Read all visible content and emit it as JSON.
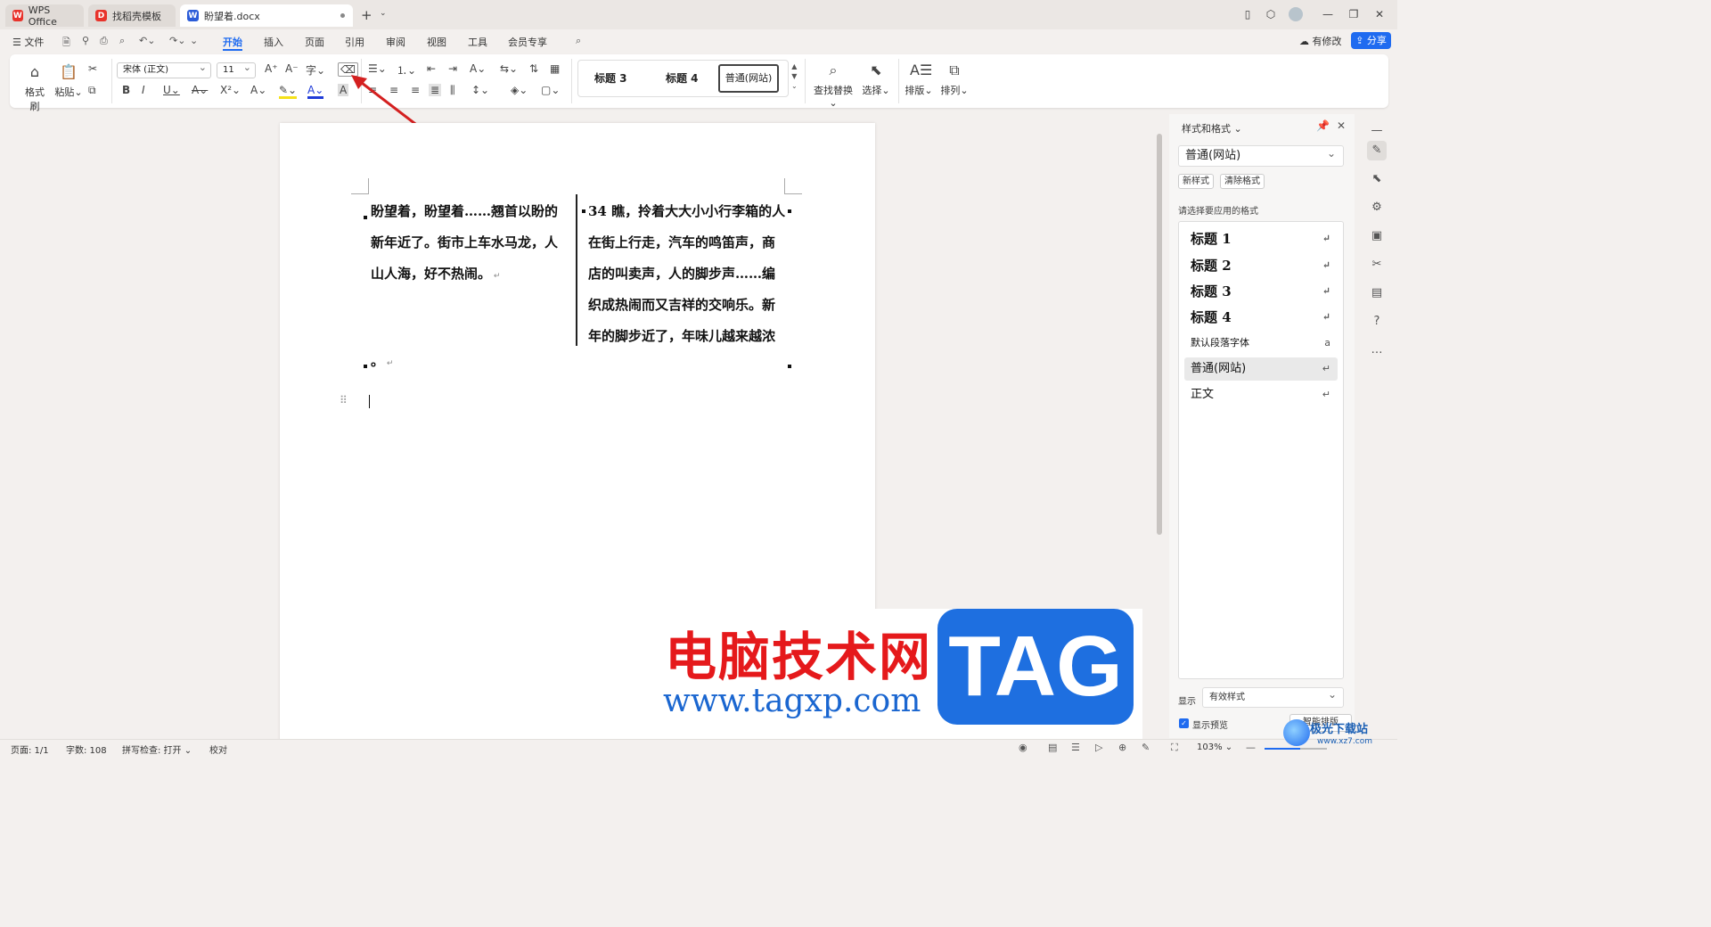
{
  "tabs": [
    {
      "label": "WPS Office"
    },
    {
      "label": "找稻壳模板"
    },
    {
      "label": "盼望着.docx"
    }
  ],
  "menu": {
    "file": "文件",
    "items": [
      "开始",
      "插入",
      "页面",
      "引用",
      "审阅",
      "视图",
      "工具",
      "会员专享"
    ],
    "modified": "有修改",
    "share": "分享"
  },
  "ribbon": {
    "format_painter": "格式刷",
    "paste": "粘贴",
    "font_name": "宋体 (正文)",
    "font_size": "11",
    "styles": [
      "标题 3",
      "标题 4",
      "普通(网站)"
    ],
    "find_replace": "查找替换",
    "select": "选择",
    "layout": "排版",
    "arrange": "排列"
  },
  "document": {
    "left_column": [
      "盼望着，盼望着……翘首以盼的",
      "新年近了。街市上车水马龙，人",
      "山人海，好不热闹。"
    ],
    "right_column": [
      "34 瞧，拎着大大小小行李箱的人",
      "在街上行走，汽车的鸣笛声，商",
      "店的叫卖声，人的脚步声……编",
      "织成热闹而又吉祥的交响乐。新",
      "年的脚步近了，年味儿越来越浓"
    ],
    "trailing": "。"
  },
  "watermark": {
    "cn": "电脑技术网",
    "url": "www.tagxp.com",
    "tag": "TAG"
  },
  "panel": {
    "title": "样式和格式",
    "current": "普通(网站)",
    "new_style": "新样式",
    "clear_format": "清除格式",
    "apply_label": "请选择要应用的格式",
    "list": [
      "标题 1",
      "标题 2",
      "标题 3",
      "标题 4",
      "默认段落字体",
      "普通(网站)",
      "正文"
    ],
    "show_label": "显示",
    "show_value": "有效样式",
    "preview_label": "显示预览",
    "smart_layout": "智能排版"
  },
  "status": {
    "page": "页面: 1/1",
    "words": "字数: 108",
    "spellcheck": "拼写检查: 打开",
    "proof": "校对",
    "zoom": "103%"
  },
  "corner_logo": {
    "name": "极光下载站",
    "url": "www.xz7.com"
  },
  "colors": {
    "accent": "#1f6bf0",
    "arrow": "#d42020",
    "watermark_red": "#e5191b",
    "watermark_blue": "#1e6fe0"
  }
}
